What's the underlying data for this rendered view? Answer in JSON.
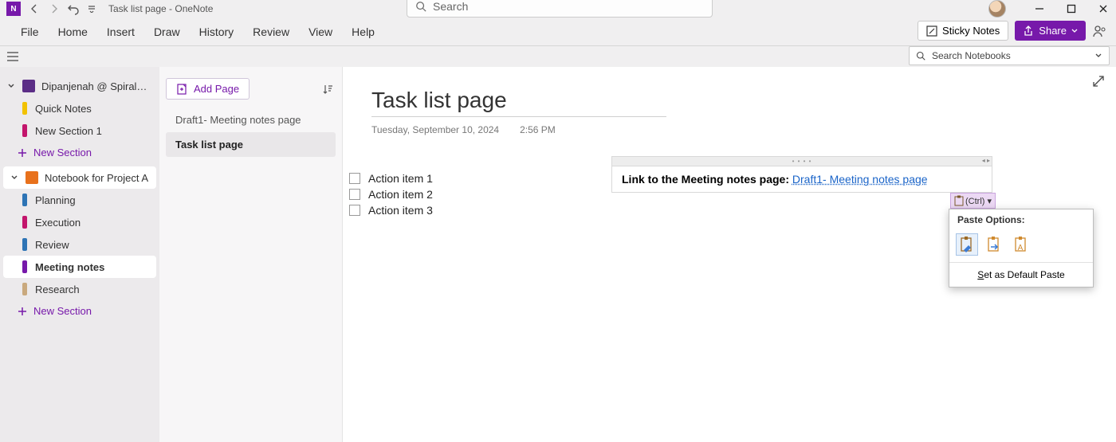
{
  "titlebar": {
    "doc_title": "Task list page  -  OneNote"
  },
  "search": {
    "placeholder": "Search"
  },
  "menus": {
    "file": "File",
    "home": "Home",
    "insert": "Insert",
    "draw": "Draw",
    "history": "History",
    "review": "Review",
    "view": "View",
    "help": "Help"
  },
  "right_menu": {
    "sticky": "Sticky Notes",
    "share": "Share"
  },
  "search_notebooks": {
    "placeholder": "Search Notebooks"
  },
  "notebooks": {
    "nb1": {
      "name": "Dipanjenah @ Spiral…",
      "sections": {
        "quick": "Quick Notes",
        "new1": "New Section 1"
      },
      "new_section": "New Section"
    },
    "nb2": {
      "name": "Notebook for Project A",
      "sections": {
        "planning": "Planning",
        "execution": "Execution",
        "review": "Review",
        "meeting": "Meeting notes",
        "research": "Research"
      },
      "new_section": "New Section"
    }
  },
  "pagelist": {
    "add": "Add Page",
    "p1": "Draft1- Meeting notes page",
    "p2": "Task list page"
  },
  "page": {
    "title": "Task list page",
    "date": "Tuesday, September 10, 2024",
    "time": "2:56 PM",
    "items": {
      "a1": "Action item 1",
      "a2": "Action item 2",
      "a3": "Action item 3"
    },
    "note_label": "Link to the Meeting notes page: ",
    "note_link": "Draft1- Meeting notes page"
  },
  "ctrl_badge": "(Ctrl) ▾",
  "paste": {
    "title": "Paste Options:",
    "footer": "Set as Default Paste"
  }
}
